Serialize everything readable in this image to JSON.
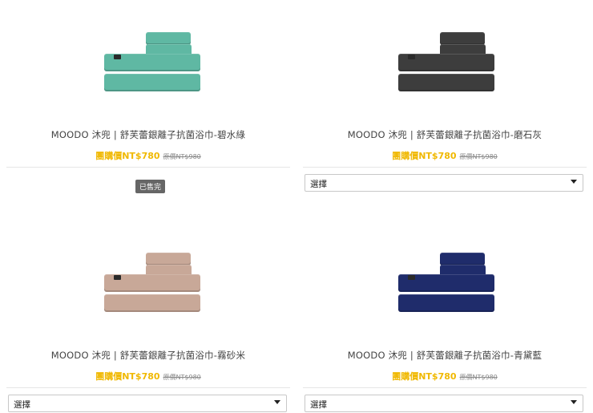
{
  "products": [
    {
      "name": "MOODO 沐兜 | 舒芙蕾銀離子抗菌浴巾-碧水綠",
      "price": "團購價NT$780",
      "original": "原價NT$980",
      "color": "#5fb8a3",
      "status": "已售完",
      "towel_icon": "towel-set-image"
    },
    {
      "name": "MOODO 沐兜 | 舒芙蕾銀離子抗菌浴巾-磨石灰",
      "price": "團購價NT$780",
      "original": "原價NT$980",
      "color": "#3d3d3d",
      "select_value": "選擇",
      "towel_icon": "towel-set-image"
    },
    {
      "name": "MOODO 沐兜 | 舒芙蕾銀離子抗菌浴巾-霧砂米",
      "price": "團購價NT$780",
      "original": "原價NT$980",
      "color": "#c8a898",
      "select_value": "選擇",
      "towel_icon": "towel-set-image"
    },
    {
      "name": "MOODO 沐兜 | 舒芙蕾銀離子抗菌浴巾-青黛藍",
      "price": "團購價NT$780",
      "original": "原價NT$980",
      "color": "#1f2c6b",
      "select_value": "選擇",
      "towel_icon": "towel-set-image"
    }
  ]
}
